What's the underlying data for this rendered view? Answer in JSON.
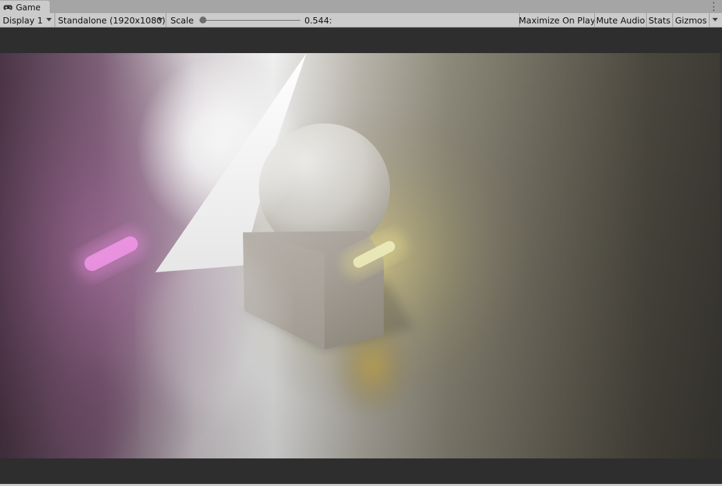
{
  "window": {
    "tab_label": "Game",
    "tab_icon": "gamepad-icon",
    "menu_icon": "kebab-menu-icon"
  },
  "toolbar": {
    "display_label": "Display 1",
    "resolution_label": "Standalone (1920x1080)",
    "scale_label": "Scale",
    "scale_value": "0.544:",
    "scale_fraction": 0.03,
    "maximize_label": "Maximize On Play",
    "mute_label": "Mute Audio",
    "stats_label": "Stats",
    "gizmos_label": "Gizmos"
  },
  "scene": {
    "objects": [
      "triangle",
      "sphere",
      "cube",
      "pink-capsule-light",
      "yellow-capsule-light",
      "white-point-light"
    ],
    "colors": {
      "pink_light": "#ff9ff4",
      "yellow_light": "#fffcc8",
      "white_light": "#ffffff"
    }
  }
}
